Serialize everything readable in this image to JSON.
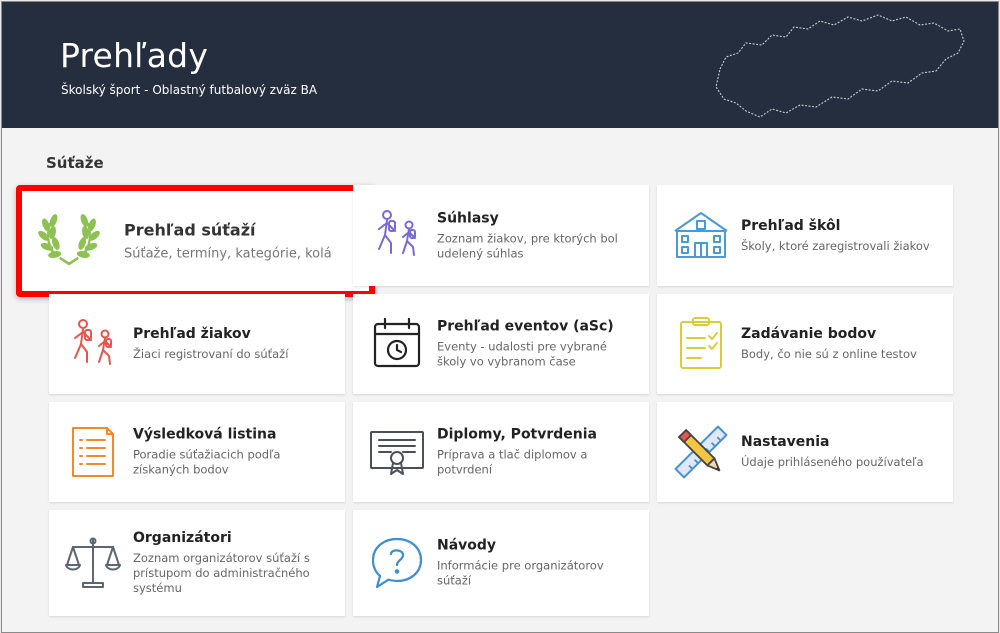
{
  "header": {
    "title": "Prehľady",
    "subtitle": "Školský šport - Oblastný futbalový zväz BA"
  },
  "section": {
    "title": "Súťaže"
  },
  "cards": [
    {
      "title": "Prehľad súťaží",
      "desc": "Súťaže, termíny, kategórie, kolá",
      "icon": "laurel-wreath-icon",
      "color": "#8dc152"
    },
    {
      "title": "Súhlasy",
      "desc": "Zoznam žiakov, pre ktorých bol udelený súhlas",
      "icon": "hikers-icon",
      "color": "#7a6ad8"
    },
    {
      "title": "Prehľad škôl",
      "desc": "Školy, ktoré zaregistrovali žiakov",
      "icon": "school-building-icon",
      "color": "#4a9ad6"
    },
    {
      "title": "Prehľad žiakov",
      "desc": "Žiaci registrovaní do súťaží",
      "icon": "hikers-icon",
      "color": "#e8554e"
    },
    {
      "title": "Prehľad eventov (aSc)",
      "desc": "Eventy - udalosti pre vybrané školy vo vybranom čase",
      "icon": "calendar-clock-icon",
      "color": "#222222"
    },
    {
      "title": "Zadávanie bodov",
      "desc": "Body, čo nie sú z online testov",
      "icon": "checklist-clipboard-icon",
      "color": "#d9cc3f"
    },
    {
      "title": "Výsledková listina",
      "desc": "Poradie súťažiacich podľa získaných bodov",
      "icon": "document-list-icon",
      "color": "#f08a2b"
    },
    {
      "title": "Diplomy, Potvrdenia",
      "desc": "Príprava a tlač diplomov a potvrdení",
      "icon": "certificate-icon",
      "color": "#4a4f59"
    },
    {
      "title": "Nastavenia",
      "desc": "Údaje prihláseného používateľa",
      "icon": "ruler-pencil-icon",
      "color": "#4a8fd0"
    },
    {
      "title": "Organizátori",
      "desc": "Zoznam organizátorov súťaží s prístupom do administračného systému",
      "icon": "scales-icon",
      "color": "#5a6672"
    },
    {
      "title": "Návody",
      "desc": "Informácie pre organizátorov súťaží",
      "icon": "question-bubble-icon",
      "color": "#3d8ed2"
    }
  ]
}
